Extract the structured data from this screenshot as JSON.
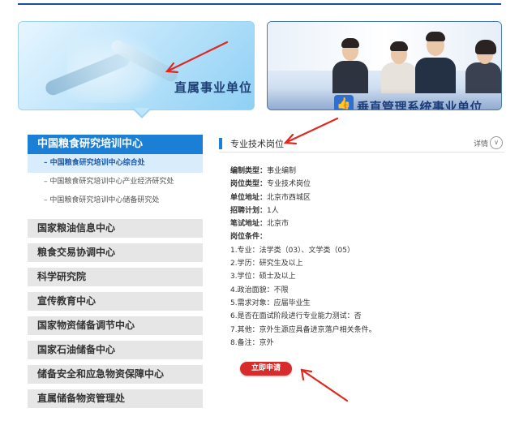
{
  "banners": {
    "left_title": "直属事业单位",
    "right_title": "垂直管理系统事业单位"
  },
  "sidebar": {
    "active": "中国粮食研究培训中心",
    "sub_items": [
      "– 中国粮食研究培训中心综合处",
      "– 中国粮食研究培训中心产业经济研究处",
      "– 中国粮食研究培训中心储备研究处"
    ],
    "items": [
      "国家粮油信息中心",
      "粮食交易协调中心",
      "科学研究院",
      "宣传教育中心",
      "国家物资储备调节中心",
      "国家石油储备中心",
      "储备安全和应急物资保障中心",
      "直属储备物资管理处"
    ]
  },
  "main": {
    "title": "专业技术岗位",
    "more": "详情",
    "fields": [
      {
        "label": "编制类型：",
        "value": "事业编制"
      },
      {
        "label": "岗位类型：",
        "value": "专业技术岗位"
      },
      {
        "label": "单位地址：",
        "value": "北京市西城区"
      },
      {
        "label": "招聘计划：",
        "value": "1人"
      },
      {
        "label": "笔试地址：",
        "value": "北京市"
      },
      {
        "label": "岗位条件：",
        "value": ""
      }
    ],
    "conditions": [
      "1.专业：法学类（03）、文学类（05）",
      "2.学历：研究生及以上",
      "3.学位：硕士及以上",
      "4.政治面貌：不限",
      "5.需求对象：应届毕业生",
      "6.是否在面试阶段进行专业能力测试：否",
      "7.其他：京外生源应具备进京落户相关条件。",
      "8.备注：京外"
    ],
    "apply_label": "立即申请"
  },
  "colors": {
    "accent": "#1c7fd6",
    "apply": "#d82c2c",
    "arrow": "#e0281f"
  }
}
